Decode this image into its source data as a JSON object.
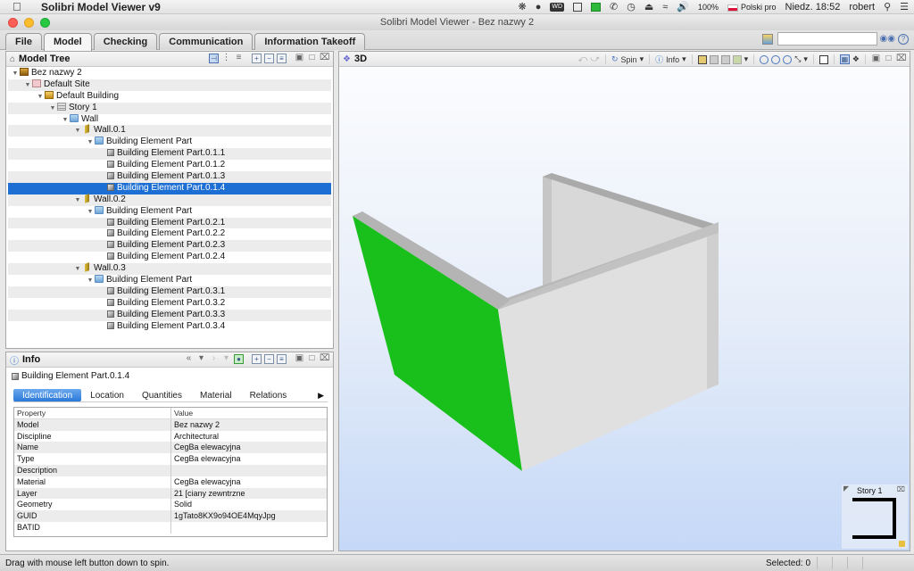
{
  "menubar": {
    "app_name": "Solibri Model Viewer v9",
    "battery": "100%",
    "input_source": "Polski pro",
    "clock": "Niedz. 18:52",
    "user": "robert"
  },
  "window": {
    "title": "Solibri Model Viewer - Bez nazwy 2"
  },
  "ribbon": {
    "tabs": [
      {
        "label": "File",
        "active": false
      },
      {
        "label": "Model",
        "active": true
      },
      {
        "label": "Checking",
        "active": false
      },
      {
        "label": "Communication",
        "active": false
      },
      {
        "label": "Information Takeoff",
        "active": false
      }
    ],
    "search_value": ""
  },
  "model_tree": {
    "title": "Model Tree",
    "items": [
      {
        "label": "Bez nazwy 2",
        "level": 0,
        "icon": "project-icon",
        "expanded": true
      },
      {
        "label": "Default Site",
        "level": 1,
        "icon": "site-icon",
        "expanded": true
      },
      {
        "label": "Default Building",
        "level": 2,
        "icon": "building-icon",
        "expanded": true
      },
      {
        "label": "Story 1",
        "level": 3,
        "icon": "story-icon",
        "expanded": true
      },
      {
        "label": "Wall",
        "level": 4,
        "icon": "folder-icon",
        "expanded": true
      },
      {
        "label": "Wall.0.1",
        "level": 5,
        "icon": "wall-icon",
        "expanded": true
      },
      {
        "label": "Building Element Part",
        "level": 6,
        "icon": "folder-icon",
        "expanded": true
      },
      {
        "label": "Building Element Part.0.1.1",
        "level": 7,
        "icon": "part-icon"
      },
      {
        "label": "Building Element Part.0.1.2",
        "level": 7,
        "icon": "part-icon"
      },
      {
        "label": "Building Element Part.0.1.3",
        "level": 7,
        "icon": "part-icon"
      },
      {
        "label": "Building Element Part.0.1.4",
        "level": 7,
        "icon": "part-icon",
        "selected": true
      },
      {
        "label": "Wall.0.2",
        "level": 5,
        "icon": "wall-icon",
        "expanded": true
      },
      {
        "label": "Building Element Part",
        "level": 6,
        "icon": "folder-icon",
        "expanded": true
      },
      {
        "label": "Building Element Part.0.2.1",
        "level": 7,
        "icon": "part-icon"
      },
      {
        "label": "Building Element Part.0.2.2",
        "level": 7,
        "icon": "part-icon"
      },
      {
        "label": "Building Element Part.0.2.3",
        "level": 7,
        "icon": "part-icon"
      },
      {
        "label": "Building Element Part.0.2.4",
        "level": 7,
        "icon": "part-icon"
      },
      {
        "label": "Wall.0.3",
        "level": 5,
        "icon": "wall-icon",
        "expanded": true
      },
      {
        "label": "Building Element Part",
        "level": 6,
        "icon": "folder-icon",
        "expanded": true
      },
      {
        "label": "Building Element Part.0.3.1",
        "level": 7,
        "icon": "part-icon"
      },
      {
        "label": "Building Element Part.0.3.2",
        "level": 7,
        "icon": "part-icon"
      },
      {
        "label": "Building Element Part.0.3.3",
        "level": 7,
        "icon": "part-icon"
      },
      {
        "label": "Building Element Part.0.3.4",
        "level": 7,
        "icon": "part-icon"
      }
    ]
  },
  "info": {
    "title": "Info",
    "selected_object": "Building Element Part.0.1.4",
    "tabs": [
      {
        "label": "Identification",
        "active": true
      },
      {
        "label": "Location",
        "active": false
      },
      {
        "label": "Quantities",
        "active": false
      },
      {
        "label": "Material",
        "active": false
      },
      {
        "label": "Relations",
        "active": false
      }
    ],
    "table": {
      "headers": [
        "Property",
        "Value"
      ],
      "rows": [
        [
          "Model",
          "Bez nazwy 2"
        ],
        [
          "Discipline",
          "Architectural"
        ],
        [
          "Name",
          "CegBa elewacyjna"
        ],
        [
          "Type",
          "CegBa elewacyjna"
        ],
        [
          "Description",
          ""
        ],
        [
          "Material",
          "CegBa elewacyjna"
        ],
        [
          "Layer",
          "21 [ciany zewntrzne"
        ],
        [
          "Geometry",
          "Solid"
        ],
        [
          "GUID",
          "1gTato8KX9o94OE4MqyJpg"
        ],
        [
          "BATID",
          ""
        ]
      ]
    }
  },
  "view3d": {
    "title": "3D",
    "spin_label": "Spin",
    "info_label": "Info",
    "colors": {
      "selected_face": "#19c01c",
      "wall_face": "#dcdcdc"
    },
    "minimap_title": "Story 1"
  },
  "status": {
    "message": "Drag with mouse left button down to spin.",
    "selected": "Selected: 0"
  }
}
